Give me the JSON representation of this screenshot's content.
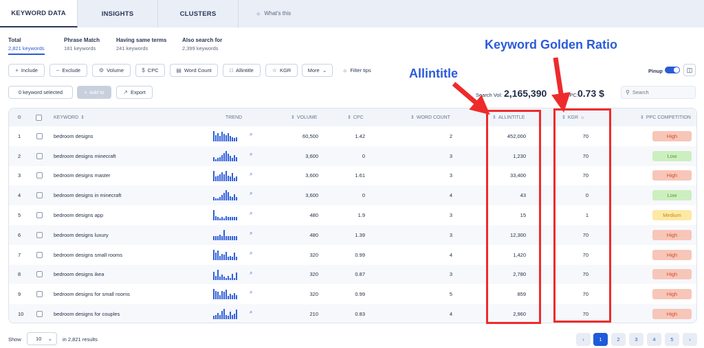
{
  "tabs": {
    "keyword_data": "KEYWORD DATA",
    "insights": "INSIGHTS",
    "clusters": "CLUSTERS",
    "whats_this": "What's this"
  },
  "subtabs": [
    {
      "title": "Total",
      "count": "2,821 keywords"
    },
    {
      "title": "Phrase Match",
      "count": "181 keywords"
    },
    {
      "title": "Having same terms",
      "count": "241 keywords"
    },
    {
      "title": "Also search for",
      "count": "2,399 keywords"
    }
  ],
  "filters": {
    "include": "Include",
    "exclude": "Exclude",
    "volume": "Volume",
    "cpc": "CPC",
    "word_count": "Word Count",
    "allintitle": "Allintitle",
    "kgr": "KGR",
    "more": "More",
    "filter_tips": "Filter tips"
  },
  "annotations": {
    "allintitle": "Allintitle",
    "kgr": "Keyword Golden Ratio"
  },
  "pinup": "Pinup",
  "toolbar": {
    "keyword_selected": "0 keyword selected",
    "add_to": "Add to",
    "export": "Export"
  },
  "stats": {
    "search_vol_label": "Search Vol:",
    "search_vol_value": "2,165,390",
    "cpc_label": "CPC:",
    "cpc_value": "0.73 $"
  },
  "search": {
    "placeholder": "Search"
  },
  "table": {
    "headers": {
      "keyword": "KEYWORD",
      "trend": "TREND",
      "volume": "VOLUME",
      "cpc": "CPC",
      "word_count": "WORD COUNT",
      "allintitle": "ALLINTITLE",
      "kgr": "KGR",
      "ppc_competition": "PPC COMPETITION"
    },
    "rows": [
      {
        "n": "1",
        "keyword": "bedroom designs",
        "volume": "60,500",
        "cpc": "1.42",
        "wc": "2",
        "allintitle": "452,000",
        "kgr": "70",
        "ppc": "High",
        "trend": [
          10,
          6,
          8,
          5,
          9,
          7,
          6,
          8,
          5,
          4,
          3,
          4
        ]
      },
      {
        "n": "2",
        "keyword": "bedroom designs minecraft",
        "volume": "3,600",
        "cpc": "0",
        "wc": "3",
        "allintitle": "1,230",
        "kgr": "70",
        "ppc": "Low",
        "trend": [
          4,
          2,
          3,
          4,
          6,
          8,
          10,
          7,
          5,
          3,
          6,
          4
        ]
      },
      {
        "n": "3",
        "keyword": "bedroom designs master",
        "volume": "3,600",
        "cpc": "1.61",
        "wc": "3",
        "allintitle": "33,400",
        "kgr": "70",
        "ppc": "High",
        "trend": [
          9,
          4,
          5,
          6,
          8,
          6,
          9,
          5,
          4,
          7,
          3,
          4
        ]
      },
      {
        "n": "4",
        "keyword": "bedroom designs in minecraft",
        "volume": "3,600",
        "cpc": "0",
        "wc": "4",
        "allintitle": "43",
        "kgr": "0",
        "ppc": "Low",
        "trend": [
          3,
          2,
          2,
          3,
          5,
          7,
          10,
          8,
          4,
          3,
          6,
          3
        ]
      },
      {
        "n": "5",
        "keyword": "bedroom designs app",
        "volume": "480",
        "cpc": "1.9",
        "wc": "3",
        "allintitle": "15",
        "kgr": "1",
        "ppc": "Medium",
        "trend": [
          10,
          4,
          3,
          2,
          3,
          2,
          4,
          3,
          3,
          3,
          3,
          3
        ]
      },
      {
        "n": "6",
        "keyword": "bedroom designs luxury",
        "volume": "480",
        "cpc": "1.39",
        "wc": "3",
        "allintitle": "12,300",
        "kgr": "70",
        "ppc": "High",
        "trend": [
          4,
          4,
          4,
          5,
          4,
          10,
          4,
          4,
          4,
          4,
          4,
          4
        ]
      },
      {
        "n": "7",
        "keyword": "bedroom designs small rooms",
        "volume": "320",
        "cpc": "0.99",
        "wc": "4",
        "allintitle": "1,420",
        "kgr": "70",
        "ppc": "High",
        "trend": [
          10,
          7,
          9,
          4,
          6,
          5,
          8,
          3,
          4,
          3,
          7,
          3
        ]
      },
      {
        "n": "8",
        "keyword": "bedroom designs ikea",
        "volume": "320",
        "cpc": "0.87",
        "wc": "3",
        "allintitle": "2,780",
        "kgr": "70",
        "ppc": "High",
        "trend": [
          8,
          4,
          10,
          3,
          5,
          3,
          2,
          4,
          2,
          6,
          2,
          7
        ]
      },
      {
        "n": "9",
        "keyword": "bedroom designs for small rooms",
        "volume": "320",
        "cpc": "0.99",
        "wc": "5",
        "allintitle": "859",
        "kgr": "70",
        "ppc": "High",
        "trend": [
          10,
          8,
          7,
          4,
          8,
          7,
          9,
          3,
          5,
          4,
          6,
          4
        ]
      },
      {
        "n": "10",
        "keyword": "bedroom designs for couples",
        "volume": "210",
        "cpc": "0.83",
        "wc": "4",
        "allintitle": "2,960",
        "kgr": "70",
        "ppc": "High",
        "trend": [
          3,
          4,
          6,
          4,
          8,
          10,
          4,
          3,
          7,
          4,
          5,
          9
        ]
      }
    ]
  },
  "footer": {
    "show": "Show",
    "page_size": "10",
    "results": "in 2,821 results",
    "pages": [
      "1",
      "2",
      "3",
      "4",
      "5"
    ]
  },
  "colors": {
    "accent": "#2a5bd7",
    "high_bg": "#f7c6b9",
    "high_text": "#d64b2a",
    "low_bg": "#cdefbf",
    "low_text": "#4e9a36",
    "medium_bg": "#fde9a6",
    "medium_text": "#c58a10",
    "annotation_red": "#ee2b2b"
  }
}
